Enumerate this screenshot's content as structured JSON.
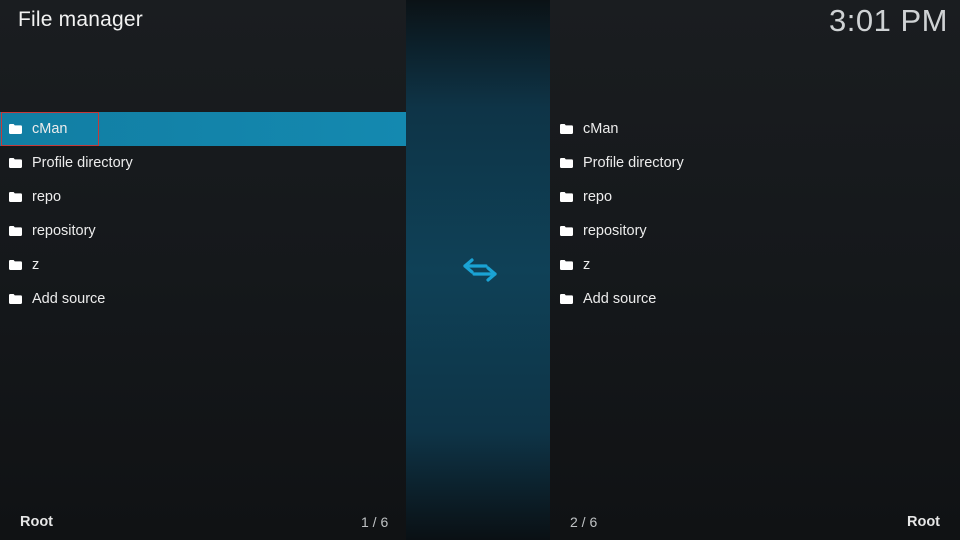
{
  "header": {
    "title": "File manager",
    "clock": "3:01 PM"
  },
  "left_pane": {
    "items": [
      {
        "label": "cMan",
        "icon": "folder-icon",
        "selected": true
      },
      {
        "label": "Profile directory",
        "icon": "folder-icon"
      },
      {
        "label": "repo",
        "icon": "folder-icon"
      },
      {
        "label": "repository",
        "icon": "folder-icon"
      },
      {
        "label": "z",
        "icon": "folder-icon"
      },
      {
        "label": "Add source",
        "icon": "folder-icon"
      }
    ],
    "path": "Root",
    "position": "1 / 6"
  },
  "right_pane": {
    "items": [
      {
        "label": "cMan",
        "icon": "folder-icon"
      },
      {
        "label": "Profile directory",
        "icon": "folder-icon"
      },
      {
        "label": "repo",
        "icon": "folder-icon"
      },
      {
        "label": "repository",
        "icon": "folder-icon"
      },
      {
        "label": "z",
        "icon": "folder-icon"
      },
      {
        "label": "Add source",
        "icon": "folder-icon"
      }
    ],
    "path": "Root",
    "position": "2 / 6"
  },
  "center": {
    "icon": "swap-arrows-icon"
  },
  "colors": {
    "accent": "#1489b0",
    "swap_icon": "#1aa3d4",
    "focus_outline": "#c43a3a"
  }
}
